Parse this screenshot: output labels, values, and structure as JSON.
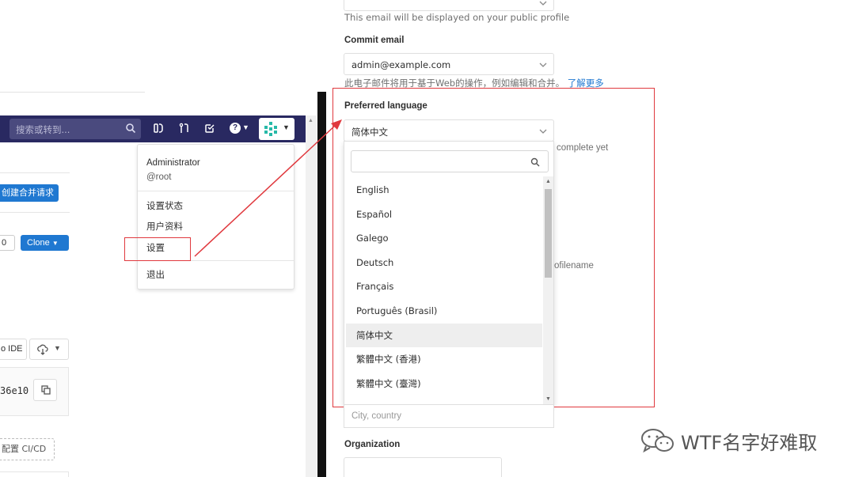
{
  "left": {
    "search_placeholder": "搜索或转到...",
    "create_mr_label": "创建合并请求",
    "count_value": "0",
    "clone_label": "Clone",
    "web_ide_label": "o IDE",
    "commit_sha": "36e10",
    "setup_cicd_label": "配置 CI/CD",
    "user_menu": {
      "name": "Administrator",
      "handle": "@root",
      "set_status": "设置状态",
      "profile": "用户资料",
      "settings": "设置",
      "sign_out": "退出"
    }
  },
  "right": {
    "public_email_help": "This email will be displayed on your public profile",
    "commit_email_label": "Commit email",
    "commit_email_value": "admin@example.com",
    "commit_email_help": "此电子邮件将用于基于Web的操作，例如编辑和合并。",
    "learn_more": "了解更多",
    "preferred_language_label": "Preferred language",
    "preferred_language_value": "简体中文",
    "peek_complete": "complete yet",
    "peek_profilename": "ofilename",
    "language_options": [
      "English",
      "Español",
      "Galego",
      "Deutsch",
      "Français",
      "Português (Brasil)",
      "简体中文",
      "繁體中文 (香港)",
      "繁體中文 (臺灣)"
    ],
    "selected_language_index": 6,
    "location_placeholder": "City, country",
    "organization_label": "Organization"
  },
  "watermark": "WTF名字好难取",
  "colors": {
    "navbar": "#292961",
    "primary_button": "#1f78d1",
    "annotation_red": "#e0393e"
  }
}
